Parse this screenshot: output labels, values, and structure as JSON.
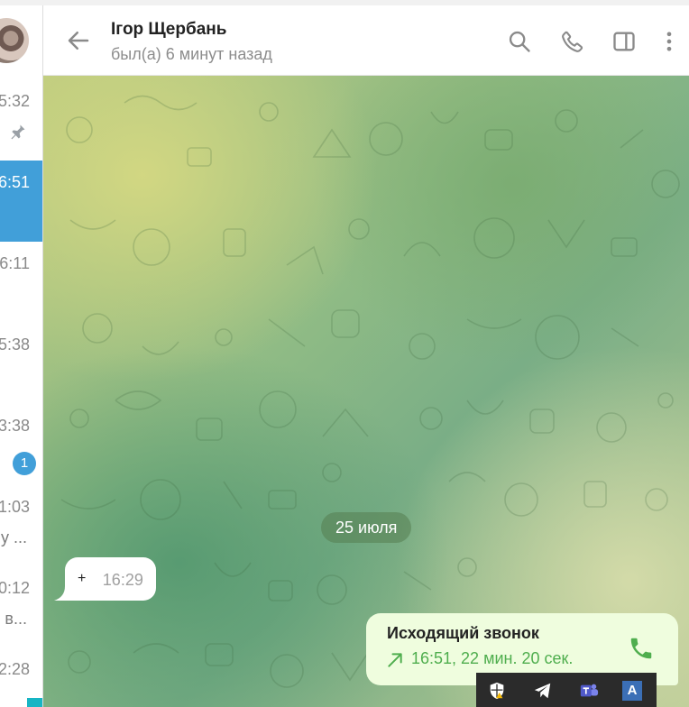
{
  "sidebar": {
    "items": [
      {
        "time": "5:32",
        "snippet": "",
        "pinned": true
      },
      {
        "time": "6:51",
        "snippet": "",
        "active": true
      },
      {
        "time": "6:11",
        "snippet": ""
      },
      {
        "time": "5:38",
        "snippet": ""
      },
      {
        "time": "3:38",
        "snippet": "",
        "badge": "1"
      },
      {
        "time": "1:03",
        "snippet": "у ..."
      },
      {
        "time": "0:12",
        "snippet": "в..."
      },
      {
        "time": "2:28",
        "snippet": ""
      }
    ]
  },
  "header": {
    "title": "Ігор Щербань",
    "status": "был(а) 6 минут назад",
    "icons": [
      "back-arrow-icon",
      "search-icon",
      "phone-icon",
      "sidebar-toggle-icon",
      "more-vertical-icon"
    ]
  },
  "chat": {
    "date_separator": "25 июля",
    "messages": [
      {
        "direction": "incoming",
        "text": "+",
        "time": "16:29"
      },
      {
        "direction": "outgoing",
        "type": "call",
        "title": "Исходящий звонок",
        "meta": "16:51, 22 мин. 20 сек."
      }
    ]
  },
  "colors": {
    "accent": "#419fd9",
    "outgoing_bubble": "#effdde",
    "call_green": "#4fae4e"
  },
  "tray": {
    "icons": [
      "shield-warning-icon",
      "telegram-icon",
      "teams-icon",
      "keyboard-layout-icon"
    ],
    "layout_label": "A"
  }
}
